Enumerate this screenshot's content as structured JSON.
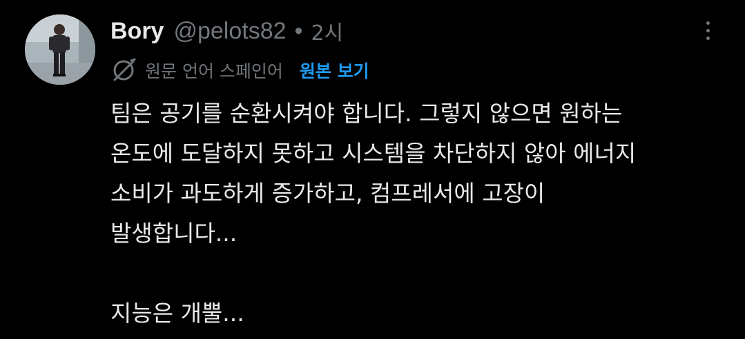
{
  "tweet": {
    "display_name": "Bory",
    "handle": "@pelots82",
    "separator": "•",
    "time": "2시",
    "translation": {
      "icon": "translate-globe-icon",
      "label": "원문 언어 스페인어",
      "show_original": "원본 보기"
    },
    "text_lines": [
      "팀은 공기를 순환시켜야 합니다. 그렇지 않으면 원하는",
      "온도에 도달하지 못하고 시스템을 차단하지 않아 에너지",
      "소비가 과도하게 증가하고, 컴프레서에 고장이",
      "발생합니다...",
      "",
      "지능은 개뿔..."
    ],
    "more_icon": "more-vertical-icon"
  },
  "colors": {
    "background": "#000000",
    "primary_text": "#e7e9ea",
    "secondary_text": "#71767b",
    "link": "#1d9bf0"
  }
}
